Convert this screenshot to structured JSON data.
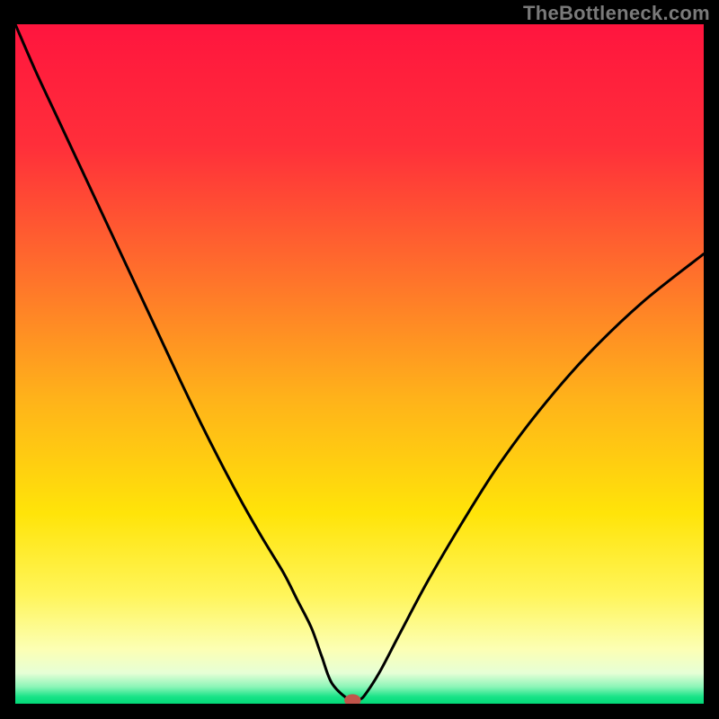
{
  "attribution": "TheBottleneck.com",
  "chart_data": {
    "type": "line",
    "title": "",
    "xlabel": "",
    "ylabel": "",
    "xlim": [
      0,
      100
    ],
    "ylim": [
      0,
      100
    ],
    "legend": false,
    "grid": false,
    "background_gradient": {
      "stops": [
        {
          "offset": 0.0,
          "color": "#ff153e"
        },
        {
          "offset": 0.18,
          "color": "#ff2f3a"
        },
        {
          "offset": 0.35,
          "color": "#ff6a2d"
        },
        {
          "offset": 0.55,
          "color": "#ffb21a"
        },
        {
          "offset": 0.72,
          "color": "#ffe409"
        },
        {
          "offset": 0.84,
          "color": "#fff55a"
        },
        {
          "offset": 0.92,
          "color": "#fcffb4"
        },
        {
          "offset": 0.955,
          "color": "#e6ffd6"
        },
        {
          "offset": 0.975,
          "color": "#8cf5b8"
        },
        {
          "offset": 0.99,
          "color": "#17e387"
        },
        {
          "offset": 1.0,
          "color": "#03d877"
        }
      ]
    },
    "series": [
      {
        "name": "bottleneck-curve",
        "color": "#000000",
        "x": [
          0,
          3,
          6,
          9,
          12,
          15,
          18,
          21,
          24,
          27,
          30,
          33,
          36,
          39,
          41,
          43,
          44.5,
          46,
          48.5,
          50,
          51,
          53,
          56,
          60,
          65,
          70,
          76,
          83,
          91,
          100
        ],
        "y": [
          100,
          93,
          86.5,
          80,
          73.5,
          67,
          60.5,
          54,
          47.5,
          41.2,
          35.2,
          29.5,
          24.2,
          19.2,
          15.2,
          11.2,
          7.0,
          3.0,
          0.6,
          0.6,
          1.6,
          4.8,
          10.6,
          18.2,
          26.8,
          34.8,
          43.0,
          51.2,
          59.0,
          66.2
        ]
      }
    ],
    "marker": {
      "name": "optimal-point",
      "x": 49,
      "y": 0.5,
      "color": "#c1544b",
      "rx": 1.2,
      "ry": 0.9
    }
  }
}
